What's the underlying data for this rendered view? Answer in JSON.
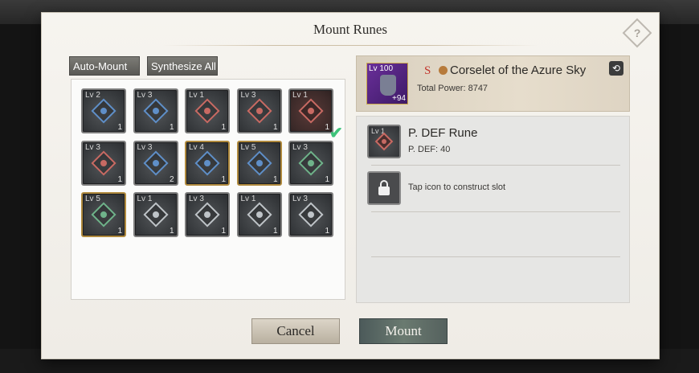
{
  "dialog": {
    "title": "Mount Runes",
    "help_icon": "question-diamond-icon"
  },
  "toolbar": {
    "auto_mount": "Auto-Mount",
    "synthesize_all": "Synthesize All"
  },
  "runes": [
    {
      "lv": "Lv 2",
      "qty": "1",
      "gem": "blue",
      "frame": "grey"
    },
    {
      "lv": "Lv 3",
      "qty": "1",
      "gem": "blue",
      "frame": "grey"
    },
    {
      "lv": "Lv 1",
      "qty": "1",
      "gem": "red",
      "frame": "grey"
    },
    {
      "lv": "Lv 3",
      "qty": "1",
      "gem": "red",
      "frame": "grey"
    },
    {
      "lv": "Lv 1",
      "qty": "1",
      "gem": "red",
      "frame": "grey",
      "selected": true
    },
    {
      "lv": "Lv 3",
      "qty": "1",
      "gem": "red",
      "frame": "grey"
    },
    {
      "lv": "Lv 3",
      "qty": "2",
      "gem": "blue",
      "frame": "grey"
    },
    {
      "lv": "Lv 4",
      "qty": "1",
      "gem": "blue",
      "frame": "gold"
    },
    {
      "lv": "Lv 5",
      "qty": "1",
      "gem": "blue",
      "frame": "gold"
    },
    {
      "lv": "Lv 3",
      "qty": "1",
      "gem": "green",
      "frame": "grey"
    },
    {
      "lv": "Lv 5",
      "qty": "1",
      "gem": "green",
      "frame": "gold"
    },
    {
      "lv": "Lv 1",
      "qty": "1",
      "gem": "white",
      "frame": "grey"
    },
    {
      "lv": "Lv 3",
      "qty": "1",
      "gem": "white",
      "frame": "grey"
    },
    {
      "lv": "Lv 1",
      "qty": "1",
      "gem": "white",
      "frame": "grey"
    },
    {
      "lv": "Lv 3",
      "qty": "1",
      "gem": "white",
      "frame": "grey"
    }
  ],
  "equipment": {
    "level": "Lv 100",
    "enhance": "+94",
    "grade": "S",
    "name": "Corselet of the Azure Sky",
    "power": "Total Power: 8747"
  },
  "slot": {
    "rune_level": "Lv 1",
    "rune_name": "P. DEF Rune",
    "rune_stat": "P. DEF: 40",
    "locked_text": "Tap icon to construct slot"
  },
  "buttons": {
    "cancel": "Cancel",
    "mount": "Mount"
  },
  "colors": {
    "blue": "#5f8fc8",
    "red": "#c86a63",
    "green": "#6fb38a",
    "white": "#bfc4c8",
    "gold_frame": "#b08a3e",
    "check": "#3fc37a"
  }
}
